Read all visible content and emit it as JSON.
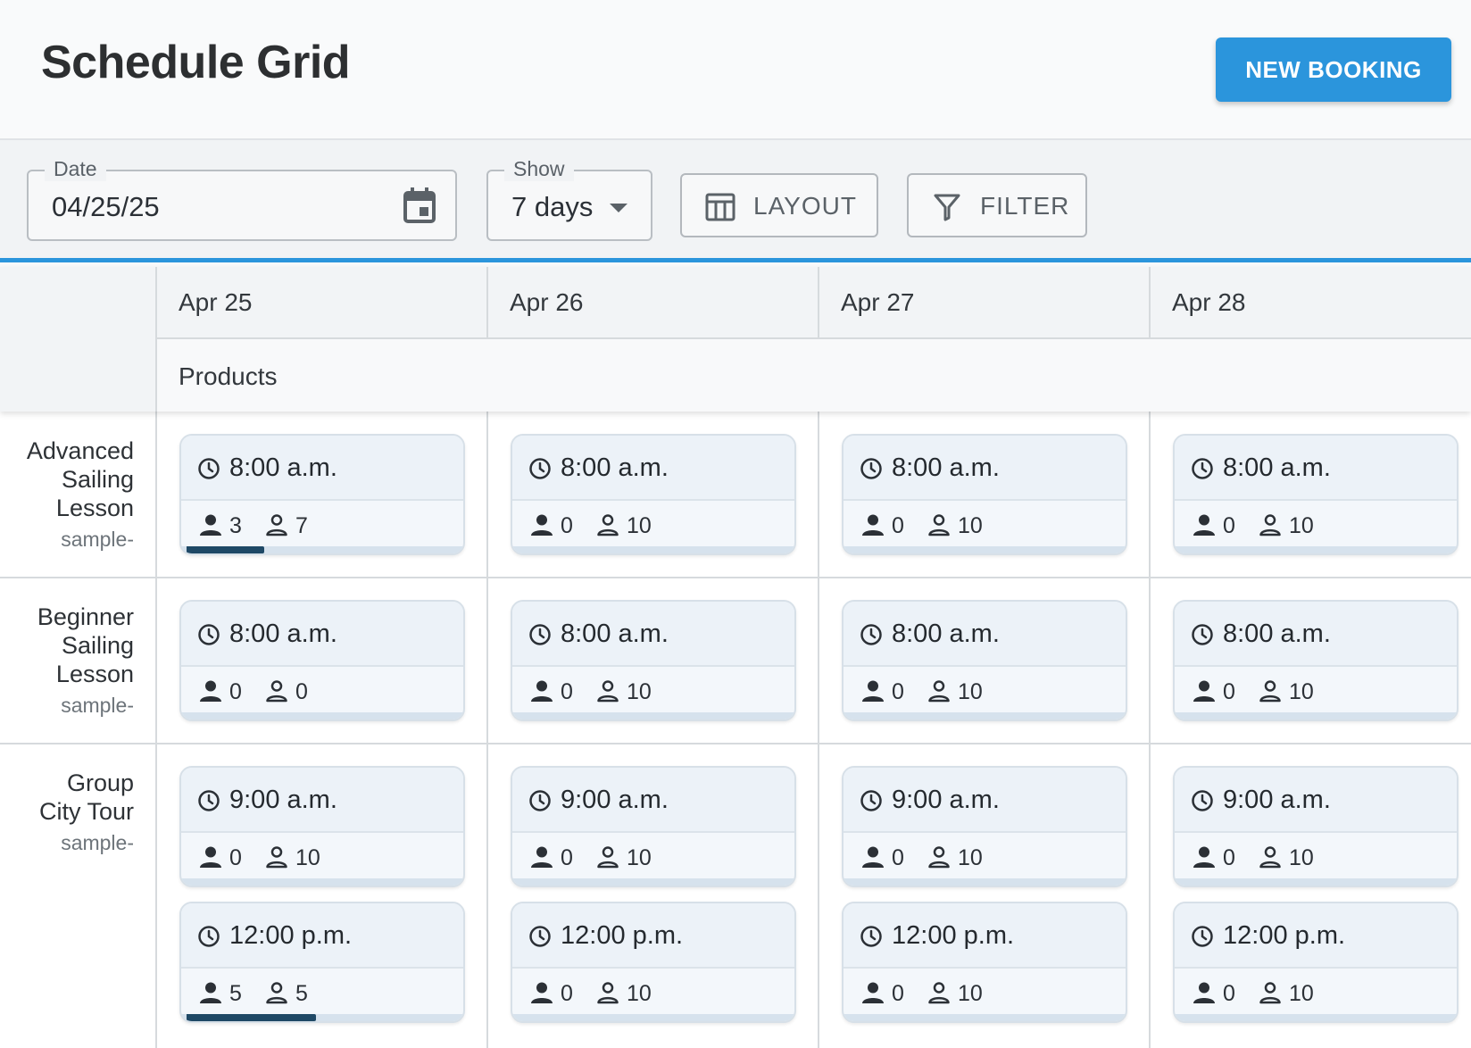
{
  "header": {
    "title": "Schedule Grid",
    "new_booking_label": "NEW BOOKING"
  },
  "toolbar": {
    "date": {
      "label": "Date",
      "value": "04/25/25",
      "icon": "calendar-icon"
    },
    "show": {
      "label": "Show",
      "value": "7 days",
      "icon": "caret-down-icon"
    },
    "layout": {
      "label": "LAYOUT",
      "icon": "table-columns-icon"
    },
    "filter": {
      "label": "FILTER",
      "icon": "funnel-icon"
    }
  },
  "grid": {
    "dates": [
      "Apr 25",
      "Apr 26",
      "Apr 27",
      "Apr 28"
    ],
    "products_header": "Products",
    "products": [
      {
        "name_lines": [
          "Advanced",
          "Sailing",
          "Lesson"
        ],
        "code": "sample-",
        "slots": [
          [
            {
              "time": "8:00 a.m.",
              "booked": "3",
              "available": "7",
              "fill": 0.3
            }
          ],
          [
            {
              "time": "8:00 a.m.",
              "booked": "0",
              "available": "10",
              "fill": 0
            }
          ],
          [
            {
              "time": "8:00 a.m.",
              "booked": "0",
              "available": "10",
              "fill": 0
            }
          ],
          [
            {
              "time": "8:00 a.m.",
              "booked": "0",
              "available": "10",
              "fill": 0
            }
          ]
        ]
      },
      {
        "name_lines": [
          "Beginner",
          "Sailing",
          "Lesson"
        ],
        "code": "sample-",
        "slots": [
          [
            {
              "time": "8:00 a.m.",
              "booked": "0",
              "available": "0",
              "fill": 0
            }
          ],
          [
            {
              "time": "8:00 a.m.",
              "booked": "0",
              "available": "10",
              "fill": 0
            }
          ],
          [
            {
              "time": "8:00 a.m.",
              "booked": "0",
              "available": "10",
              "fill": 0
            }
          ],
          [
            {
              "time": "8:00 a.m.",
              "booked": "0",
              "available": "10",
              "fill": 0
            }
          ]
        ]
      },
      {
        "name_lines": [
          "Group",
          "City Tour"
        ],
        "code": "sample-",
        "slots": [
          [
            {
              "time": "9:00 a.m.",
              "booked": "0",
              "available": "10",
              "fill": 0
            },
            {
              "time": "12:00 p.m.",
              "booked": "5",
              "available": "5",
              "fill": 0.5
            }
          ],
          [
            {
              "time": "9:00 a.m.",
              "booked": "0",
              "available": "10",
              "fill": 0
            },
            {
              "time": "12:00 p.m.",
              "booked": "0",
              "available": "10",
              "fill": 0
            }
          ],
          [
            {
              "time": "9:00 a.m.",
              "booked": "0",
              "available": "10",
              "fill": 0
            },
            {
              "time": "12:00 p.m.",
              "booked": "0",
              "available": "10",
              "fill": 0
            }
          ],
          [
            {
              "time": "9:00 a.m.",
              "booked": "0",
              "available": "10",
              "fill": 0
            },
            {
              "time": "12:00 p.m.",
              "booked": "0",
              "available": "10",
              "fill": 0
            }
          ]
        ]
      }
    ]
  },
  "colors": {
    "accent": "#2b95dc",
    "capacity_fill": "#1f4966"
  }
}
